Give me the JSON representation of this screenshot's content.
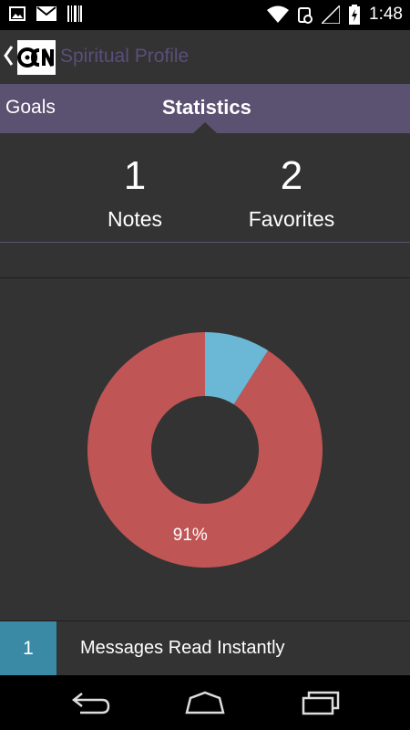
{
  "status_bar": {
    "time": "1:48",
    "icons": [
      "image-icon",
      "mail-icon",
      "barcode-icon",
      "wifi-icon",
      "alarm-icon",
      "signal-icon",
      "battery-icon"
    ]
  },
  "action_bar": {
    "title": "Spiritual Profile",
    "back_icon": "chevron-left-icon",
    "logo_text": "CCN"
  },
  "tabs": [
    {
      "label": "Goals",
      "selected": false
    },
    {
      "label": "Statistics",
      "selected": true
    }
  ],
  "stats": {
    "notes": {
      "value": "1",
      "label": "Notes"
    },
    "favorites": {
      "value": "2",
      "label": "Favorites"
    }
  },
  "chart_data": {
    "type": "pie",
    "donut": true,
    "slices": [
      {
        "value": 91,
        "color": "#c05555",
        "label": "91%"
      },
      {
        "value": 9,
        "color": "#6ab8d6",
        "label": ""
      }
    ]
  },
  "messages": {
    "count": "1",
    "label": "Messages Read Instantly"
  },
  "nav_bar": {
    "icons": [
      "back-icon",
      "home-icon",
      "recent-apps-icon"
    ]
  },
  "colors": {
    "accent": "#5b5171",
    "background": "#333333",
    "count_badge": "#3a8aa5"
  }
}
